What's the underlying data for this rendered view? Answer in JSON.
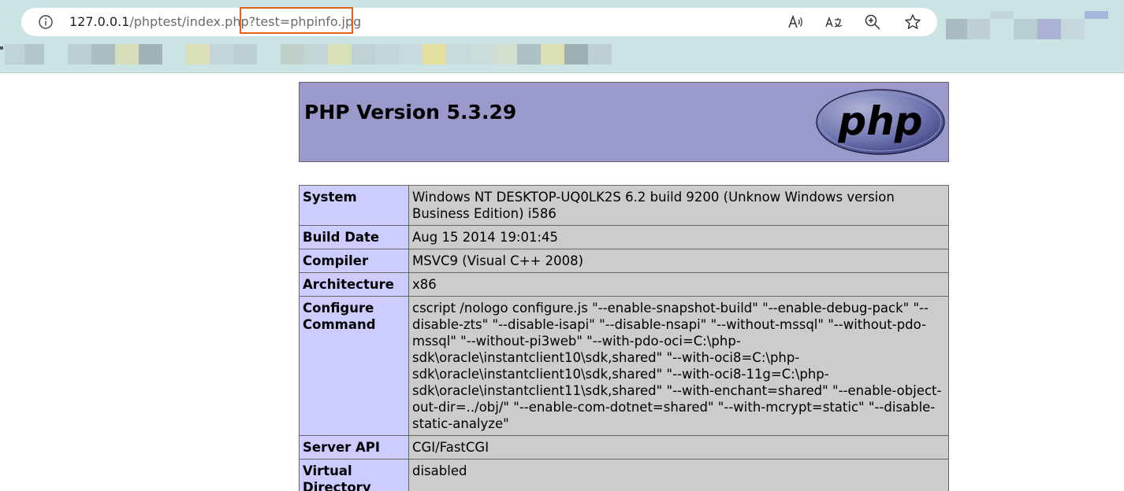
{
  "browser": {
    "url": {
      "host": "127.0.0.1",
      "path": "/phptest/index.php",
      "query": "?test=phpinfo.jpg"
    },
    "toolbar_icons": [
      "read-aloud-icon",
      "translate-icon",
      "zoom-icon",
      "favorite-star-icon"
    ],
    "accent_colors": {
      "chrome_bg": "#cce3e4",
      "highlight_box": "#e6601d"
    }
  },
  "phpinfo": {
    "title": "PHP Version 5.3.29",
    "logo_text": "php",
    "rows": [
      {
        "key": "System",
        "value": "Windows NT DESKTOP-UQ0LK2S 6.2 build 9200 (Unknow Windows version Business Edition) i586"
      },
      {
        "key": "Build Date",
        "value": "Aug 15 2014 19:01:45"
      },
      {
        "key": "Compiler",
        "value": "MSVC9 (Visual C++ 2008)"
      },
      {
        "key": "Architecture",
        "value": "x86"
      },
      {
        "key": "Configure Command",
        "value": "cscript /nologo configure.js \"--enable-snapshot-build\" \"--enable-debug-pack\" \"--disable-zts\" \"--disable-isapi\" \"--disable-nsapi\" \"--without-mssql\" \"--without-pdo-mssql\" \"--without-pi3web\" \"--with-pdo-oci=C:\\php-sdk\\oracle\\instantclient10\\sdk,shared\" \"--with-oci8=C:\\php-sdk\\oracle\\instantclient10\\sdk,shared\" \"--with-oci8-11g=C:\\php-sdk\\oracle\\instantclient11\\sdk,shared\" \"--with-enchant=shared\" \"--enable-object-out-dir=../obj/\" \"--enable-com-dotnet=shared\" \"--with-mcrypt=static\" \"--disable-static-analyze\""
      },
      {
        "key": "Server API",
        "value": "CGI/FastCGI"
      },
      {
        "key": "Virtual Directory",
        "value": "disabled"
      }
    ],
    "colors": {
      "header_bg": "#9999cc",
      "key_bg": "#ccccff",
      "value_bg": "#cccccc"
    }
  }
}
